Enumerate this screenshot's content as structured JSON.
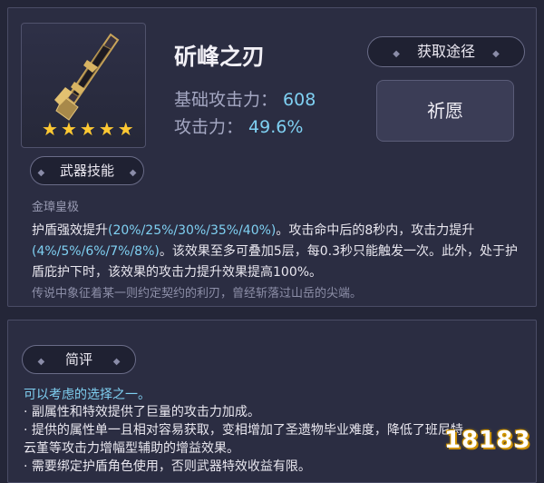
{
  "weapon": {
    "name": "斫峰之刃",
    "stars": 5,
    "base_atk_label": "基础攻击力：",
    "base_atk_value": "608",
    "sub_stat_label": "攻击力：",
    "sub_stat_value": "49.6%"
  },
  "buttons": {
    "obtain": "获取途径",
    "wish": "祈愿"
  },
  "skill": {
    "tab_label": "武器技能",
    "name": "金璋皇极",
    "desc_p1": "护盾强效提升",
    "desc_h1": "(20%/25%/30%/35%/40%)",
    "desc_p2": "。攻击命中后的8秒内，攻击力提升",
    "desc_h2": "(4%/5%/6%/7%/8%)",
    "desc_p3": "。该效果至多可叠加5层，每0.3秒只能触发一次。此外，处于护盾庇护下时，该效果的攻击力提升效果提高100%。",
    "flavor": "传说中象征着某一则约定契约的利刃，曾经斩落过山岳的尖端。"
  },
  "review": {
    "tab_label": "简评",
    "lead": "可以考虑的选择之一。",
    "items": [
      "· 副属性和特效提供了巨量的攻击力加成。",
      "· 提供的属性单一且相对容易获取，变相增加了圣遗物毕业难度，降低了班尼特、",
      "云堇等攻击力增幅型辅助的增益效果。",
      "· 需要绑定护盾角色使用，否则武器特效收益有限。"
    ]
  },
  "watermark": "18183",
  "colors": {
    "accent": "#7fd0f2",
    "star": "#ffc933",
    "panel": "#2b2d42",
    "background": "#242638"
  }
}
